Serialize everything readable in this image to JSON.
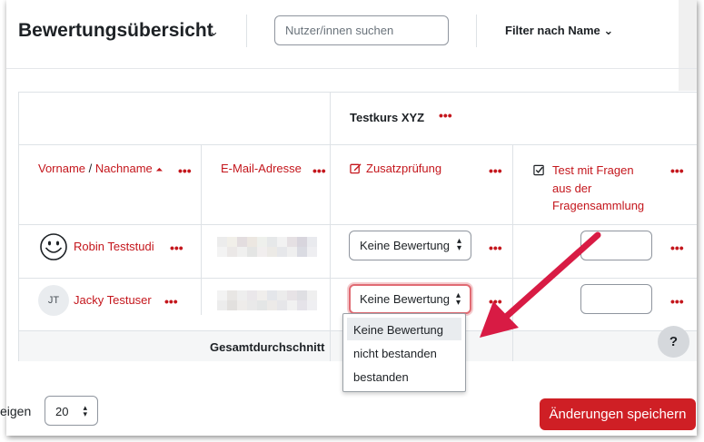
{
  "header": {
    "title": "Bewertungsübersicht",
    "title_chevron": "⌄",
    "search_placeholder": "Nutzer/innen suchen",
    "filter_label": "Filter nach Name",
    "filter_chevron": "⌄"
  },
  "table": {
    "course_title": "Testkurs XYZ",
    "more": "•••",
    "columns": {
      "firstname": "Vorname",
      "separator": " / ",
      "lastname": "Nachname",
      "sort_icon": "⏶",
      "email": "E-Mail-Adresse",
      "assignment": "Zusatzprüfung",
      "quiz_line1": "Test mit Fragen",
      "quiz_line2": "aus der",
      "quiz_line3": "Fragensammlung"
    },
    "rows": [
      {
        "name": "Robin Teststudi",
        "avatar": "smiley-icon",
        "grade": "Keine Bewertung"
      },
      {
        "name": "Jacky Testuser",
        "avatar": "JT",
        "grade": "Keine Bewertung"
      }
    ],
    "total_label": "Gesamtdurchschnitt"
  },
  "dropdown": {
    "options": [
      "Keine Bewertung",
      "nicht bestanden",
      "bestanden"
    ],
    "selected_index": 0
  },
  "help": "?",
  "footer": {
    "show_label": "eigen",
    "per_page": "20",
    "save_label": "Änderungen speichern"
  },
  "colors": {
    "accent": "#c4161c",
    "save_button": "#cf1f25",
    "arrow": "#d81b44"
  }
}
